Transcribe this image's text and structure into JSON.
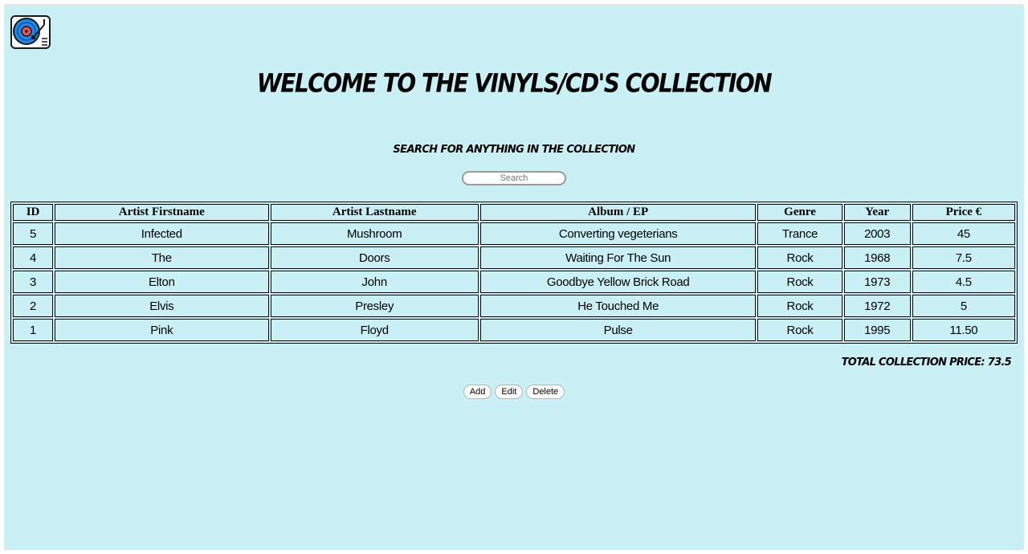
{
  "page": {
    "title": "Welcome to the Vinyls/CD's Collection",
    "search_label": "Search for anything in the collection",
    "logo_icon": "turntable-icon"
  },
  "search": {
    "placeholder": "Search",
    "value": ""
  },
  "table": {
    "headers": [
      "ID",
      "Artist Firstname",
      "Artist Lastname",
      "Album / EP",
      "Genre",
      "Year",
      "Price €"
    ],
    "rows": [
      [
        "5",
        "Infected",
        "Mushroom",
        "Converting vegeterians",
        "Trance",
        "2003",
        "45"
      ],
      [
        "4",
        "The",
        "Doors",
        "Waiting For The Sun",
        "Rock",
        "1968",
        "7.5"
      ],
      [
        "3",
        "Elton",
        "John",
        "Goodbye Yellow Brick Road",
        "Rock",
        "1973",
        "4.5"
      ],
      [
        "2",
        "Elvis",
        "Presley",
        "He Touched Me",
        "Rock",
        "1972",
        "5"
      ],
      [
        "1",
        "Pink",
        "Floyd",
        "Pulse",
        "Rock",
        "1995",
        "11.50"
      ]
    ]
  },
  "total": {
    "text": "Total collection price: 73.5"
  },
  "actions": {
    "add_label": "Add",
    "edit_label": "Edit",
    "delete_label": "Delete"
  },
  "colors": {
    "background": "#c8f0f5",
    "logo_accent": "#1e88e5"
  }
}
